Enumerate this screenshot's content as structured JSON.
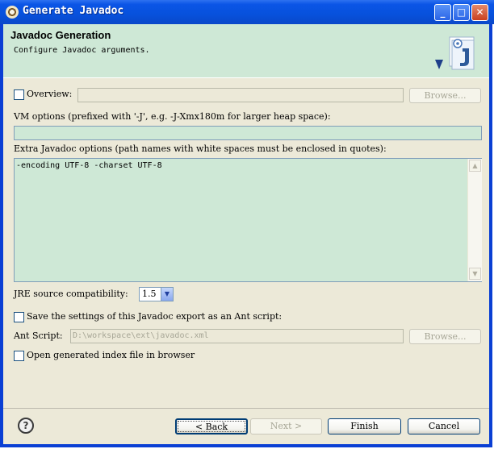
{
  "window": {
    "title": "Generate Javadoc",
    "minimize": "_",
    "maximize": "□",
    "close": "✕"
  },
  "header": {
    "title": "Javadoc Generation",
    "description": "Configure Javadoc arguments."
  },
  "overview": {
    "checkbox_label": "Overview:",
    "checked": false,
    "value": "",
    "browse_label": "Browse..."
  },
  "vm_options": {
    "label": "VM options (prefixed with '-J', e.g. -J-Xmx180m for larger heap space):",
    "value": ""
  },
  "extra_options": {
    "label": "Extra Javadoc options (path names with white spaces must be enclosed in quotes):",
    "value": "-encoding UTF-8 -charset UTF-8"
  },
  "jre": {
    "label": "JRE source compatibility:",
    "selected": "1.5"
  },
  "ant": {
    "save_checkbox_label": "Save the settings of this Javadoc export as an Ant script:",
    "save_checked": false,
    "script_label": "Ant Script:",
    "script_value": "D:\\workspace\\ext\\javadoc.xml",
    "browse_label": "Browse..."
  },
  "open_index": {
    "checkbox_label": "Open generated index file in browser",
    "checked": false
  },
  "buttons": {
    "help": "?",
    "back": "< Back",
    "next": "Next >",
    "finish": "Finish",
    "cancel": "Cancel"
  },
  "colors": {
    "title_bar": "#0b55e6",
    "header_bg": "#cee8d6",
    "dialog_bg": "#ece9d8"
  }
}
